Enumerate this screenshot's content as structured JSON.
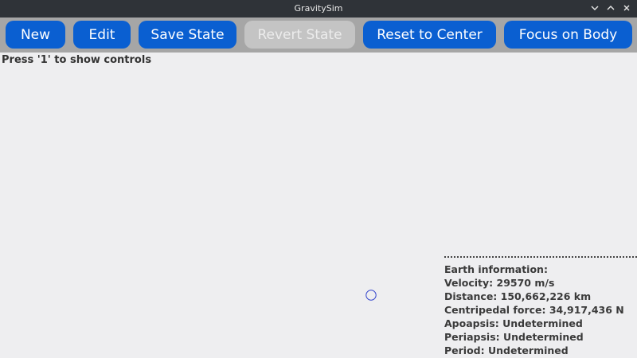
{
  "window": {
    "title": "GravitySim"
  },
  "toolbar": {
    "new_label": "New",
    "edit_label": "Edit",
    "save_state_label": "Save State",
    "revert_state_label": "Revert State",
    "reset_center_label": "Reset to Center",
    "focus_body_label": "Focus on Body"
  },
  "hint": "Press '1' to show controls",
  "info": {
    "heading": "Earth information:",
    "velocity": "Velocity: 29570 m/s",
    "distance": "Distance: 150,662,226 km",
    "centripetal": "Centripedal force: 34,917,436 N",
    "apoapsis": "Apoapsis: Undetermined",
    "periapsis": "Periapsis: Undetermined",
    "period": "Period: Undetermined"
  },
  "icons": {
    "minimize": "chevron-down-icon",
    "maximize": "chevron-up-icon",
    "close": "close-icon"
  },
  "colors": {
    "button_blue": "#0a5fd1",
    "button_disabled": "#c4c4c4",
    "toolbar_bg": "#a6a6a6",
    "titlebar_bg": "#2f3338",
    "canvas_bg": "#eeeef0",
    "body_marker": "#3344cc"
  }
}
